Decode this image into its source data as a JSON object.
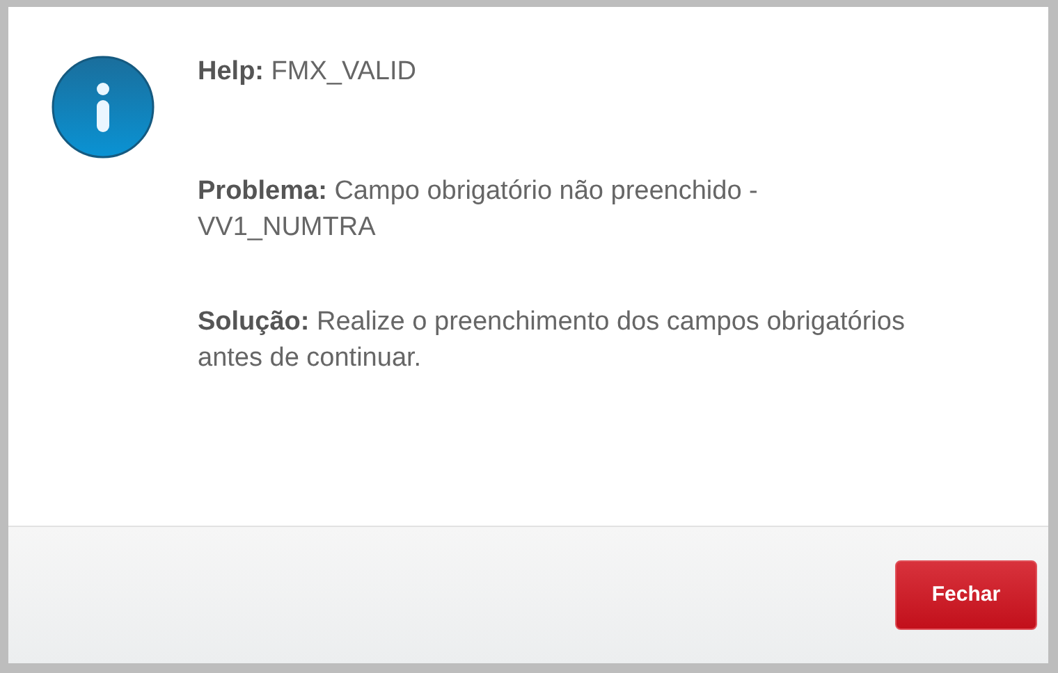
{
  "dialog": {
    "paragraphs": [
      "**Help:** FMX_VALID",
      "**Problema:** Campo obrigatório não preenchido - VV1_NUMTRA",
      "**Solução:** Realize o preenchimento dos campos obrigatórios antes de continuar."
    ],
    "buttons": [
      "Fechar"
    ]
  }
}
